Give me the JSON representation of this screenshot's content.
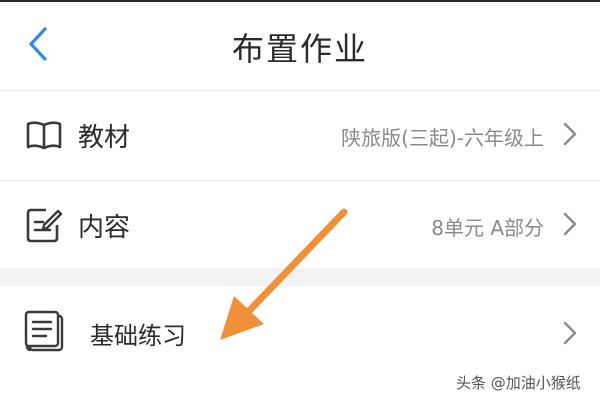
{
  "header": {
    "title": "布置作业",
    "back_icon": "chevron-left-icon"
  },
  "rows": [
    {
      "icon": "book-icon",
      "label": "教材",
      "value": "陕旅版(三起)-六年级上",
      "chevron": "chevron-right-icon"
    },
    {
      "icon": "edit-document-icon",
      "label": "内容",
      "value": "8单元 A部分",
      "chevron": "chevron-right-icon"
    },
    {
      "icon": "notebook-icon",
      "label": "基础练习",
      "value": "",
      "chevron": "chevron-right-icon"
    }
  ],
  "annotation": {
    "icon": "orange-arrow-icon",
    "color": "#F0913A"
  },
  "watermark": "头条 @加油小猴纸",
  "colors": {
    "accent": "#2F8CEB",
    "arrow": "#F0913A",
    "separator": "#F3F3F5"
  }
}
